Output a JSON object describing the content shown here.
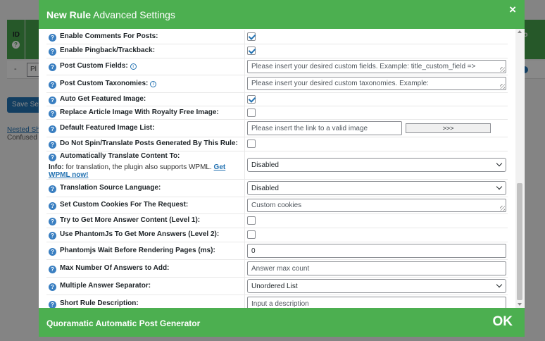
{
  "background": {
    "header_id_label": "ID",
    "header_right_label": "fo",
    "row_dash": "-",
    "row_select_value": "Pl",
    "save_button": "Save Settings",
    "link_text": "Nested Shortcodes",
    "help_text": "Confused about"
  },
  "modal": {
    "title_strong": "New Rule",
    "title_rest": "Advanced Settings",
    "close_label": "×",
    "footer_title": "Quoramatic Automatic Post Generator",
    "ok_label": "OK"
  },
  "rows": {
    "comments": {
      "label": "Enable Comments For Posts:",
      "checked": true
    },
    "pingback": {
      "label": "Enable Pingback/Trackback:",
      "checked": true
    },
    "custom_fields": {
      "label": "Post Custom Fields:",
      "placeholder": "Please insert your desired custom fields. Example: title_custom_field =>"
    },
    "custom_tax": {
      "label": "Post Custom Taxonomies:",
      "placeholder": "Please insert your desired custom taxonomies. Example:"
    },
    "auto_featured": {
      "label": "Auto Get Featured Image:",
      "checked": true
    },
    "royalty_free": {
      "label": "Replace Article Image With Royalty Free Image:",
      "checked": false
    },
    "default_image": {
      "label": "Default Featured Image List:",
      "placeholder": "Please insert the link to a valid image",
      "button": ">>>"
    },
    "no_spin": {
      "label": "Do Not Spin/Translate Posts Generated By This Rule:",
      "checked": false
    },
    "translate": {
      "label": "Automatically Translate Content To:",
      "info_prefix": "Info:",
      "info_text": "for translation, the plugin also supports WPML.",
      "info_link": "Get WPML now!",
      "value": "Disabled"
    },
    "source_lang": {
      "label": "Translation Source Language:",
      "value": "Disabled"
    },
    "cookies": {
      "label": "Set Custom Cookies For The Request:",
      "placeholder": "Custom cookies"
    },
    "more_l1": {
      "label": "Try to Get More Answer Content (Level 1):",
      "checked": false
    },
    "phantom": {
      "label": "Use PhantomJs To Get More Answers (Level 2):",
      "checked": false
    },
    "phantom_wait": {
      "label": "Phantomjs Wait Before Rendering Pages (ms):",
      "value": "0"
    },
    "max_answers": {
      "label": "Max Number Of Answers to Add:",
      "placeholder": "Answer max count"
    },
    "separator": {
      "label": "Multiple Answer Separator:",
      "value": "Unordered List"
    },
    "short_desc": {
      "label": "Short Rule Description:",
      "placeholder": "Input a description"
    }
  },
  "icons": {
    "help": "?",
    "info": "i"
  }
}
